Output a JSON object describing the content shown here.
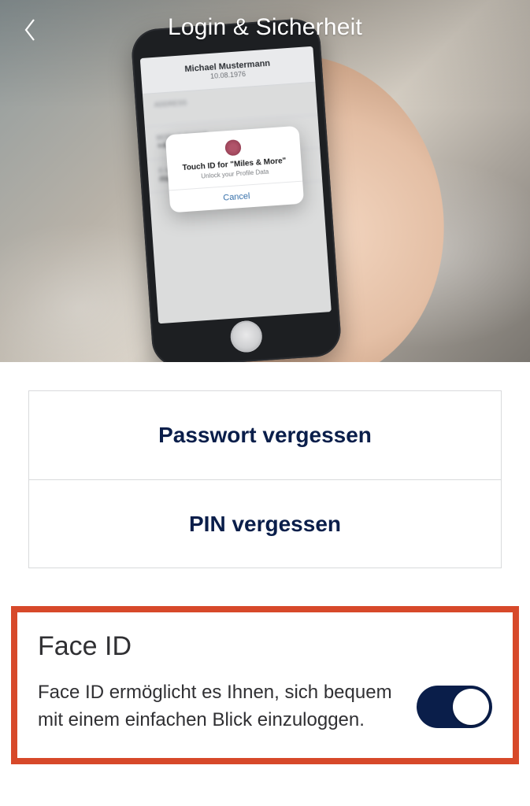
{
  "header": {
    "title": "Login & Sicherheit"
  },
  "hero_phone": {
    "profile_name": "Michael Mustermann",
    "profile_dob": "10.08.1976",
    "address_label": "Address",
    "mobile_label": "Mobile Phone",
    "mobile_value": "+49 0152 0369273x",
    "email_label": "E-Mail Adress",
    "email_value": "max@mustermann.de",
    "dialog_title": "Touch ID for \"Miles & More\"",
    "dialog_subtitle": "Unlock your Profile Data",
    "dialog_cancel": "Cancel"
  },
  "buttons": {
    "forgot_password": "Passwort vergessen",
    "forgot_pin": "PIN vergessen"
  },
  "faceid": {
    "title": "Face ID",
    "description": "Face ID ermöglicht es Ihnen, sich bequem mit einem einfachen Blick einzuloggen.",
    "enabled": true
  },
  "colors": {
    "primary": "#0a1e4a",
    "highlight_border": "#d7492a"
  }
}
